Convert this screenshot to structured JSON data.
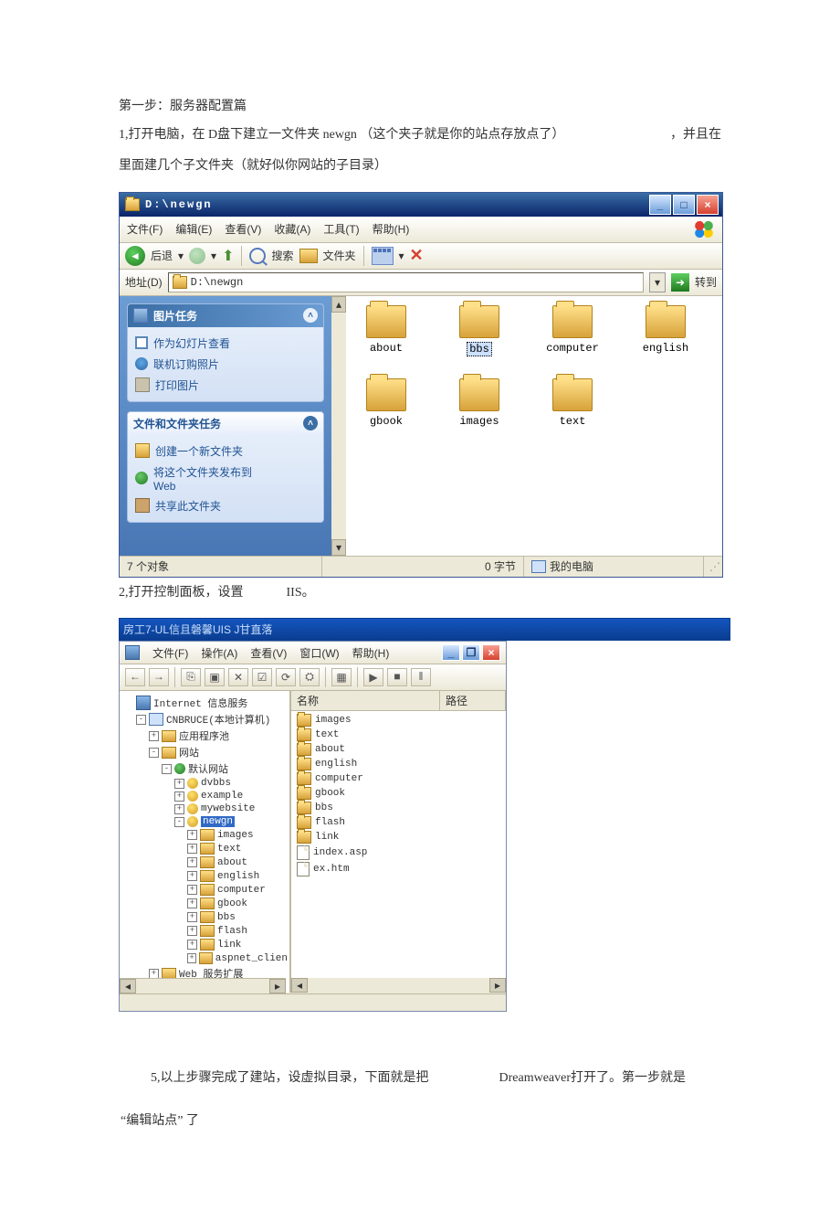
{
  "text": {
    "step1_title": "第一步：服务器配置篇",
    "step1_line1a": "1,打开电脑，在 D盘下建立一文件夹 newgn （这个夹子就是你的站点存放点了）",
    "step1_line1b": "，并且在",
    "step1_line2": "里面建几个子文件夹（就好似你网站的子目录）",
    "step2": "2,打开控制面板，设置",
    "iis_label": "IIS。",
    "step5a": "5,以上步骤完成了建站，设虚拟目录，下面就是把",
    "step5b": "Dreamweaver打开了。第一步就是",
    "step5c": "“编辑站点” 了"
  },
  "explorer": {
    "title": "D:\\newgn",
    "menus": {
      "file": "文件(F)",
      "edit": "编辑(E)",
      "view": "查看(V)",
      "fav": "收藏(A)",
      "tools": "工具(T)",
      "help": "帮助(H)"
    },
    "toolbar": {
      "back": "后退",
      "search": "搜索",
      "folders": "文件夹"
    },
    "address_label": "地址(D)",
    "address_value": "D:\\newgn",
    "go": "转到",
    "tasks": {
      "pic_title": "图片任务",
      "slideshow": "作为幻灯片查看",
      "order": "联机订购照片",
      "print": "打印图片",
      "ff_title": "文件和文件夹任务",
      "newfolder": "创建一个新文件夹",
      "publish1": "将这个文件夹发布到",
      "publish2": "Web",
      "share": "共享此文件夹"
    },
    "folders": [
      "about",
      "bbs",
      "computer",
      "english",
      "gbook",
      "images",
      "text"
    ],
    "selected": "bbs",
    "status": {
      "objects": "7 个对象",
      "size": "0 字节",
      "mycomputer": "我的电脑"
    },
    "winbtns": {
      "min": "_",
      "max": "□",
      "close": "×"
    }
  },
  "iis": {
    "bluebar": "房工7-UL信且磐馨UIS J甘直落",
    "menus": {
      "file": "文件(F)",
      "action": "操作(A)",
      "view": "查看(V)",
      "window": "窗口(W)",
      "help": "帮助(H)"
    },
    "toolbar_glyphs": [
      "←",
      "→",
      "│",
      "⎘",
      "▣",
      "✕",
      "☑",
      "⟳",
      "⛭",
      "│",
      "▦",
      "│",
      "▶",
      "■",
      "ǁ"
    ],
    "columns": {
      "name": "名称",
      "path": "路径"
    },
    "list": [
      {
        "type": "folder",
        "name": "images"
      },
      {
        "type": "folder",
        "name": "text"
      },
      {
        "type": "folder",
        "name": "about"
      },
      {
        "type": "folder",
        "name": "english"
      },
      {
        "type": "folder",
        "name": "computer"
      },
      {
        "type": "folder",
        "name": "gbook"
      },
      {
        "type": "folder",
        "name": "bbs"
      },
      {
        "type": "folder",
        "name": "flash"
      },
      {
        "type": "folder",
        "name": "link"
      },
      {
        "type": "doc",
        "name": "index.asp"
      },
      {
        "type": "doc",
        "name": "ex.htm"
      }
    ],
    "tree": {
      "root": "Internet 信息服务",
      "host": "CNBRUCE(本地计算机)",
      "apppool": "应用程序池",
      "sites": "网站",
      "default": "默认网站",
      "children": [
        "dvbbs",
        "example",
        "mywebsite"
      ],
      "newgn": "newgn",
      "newgn_children": [
        "images",
        "text",
        "about",
        "english",
        "computer",
        "gbook",
        "bbs",
        "flash",
        "link",
        "aspnet_clien"
      ],
      "webext": "Web 服务扩展"
    },
    "winbtns": {
      "min": "_",
      "max": "❐",
      "close": "×"
    }
  }
}
